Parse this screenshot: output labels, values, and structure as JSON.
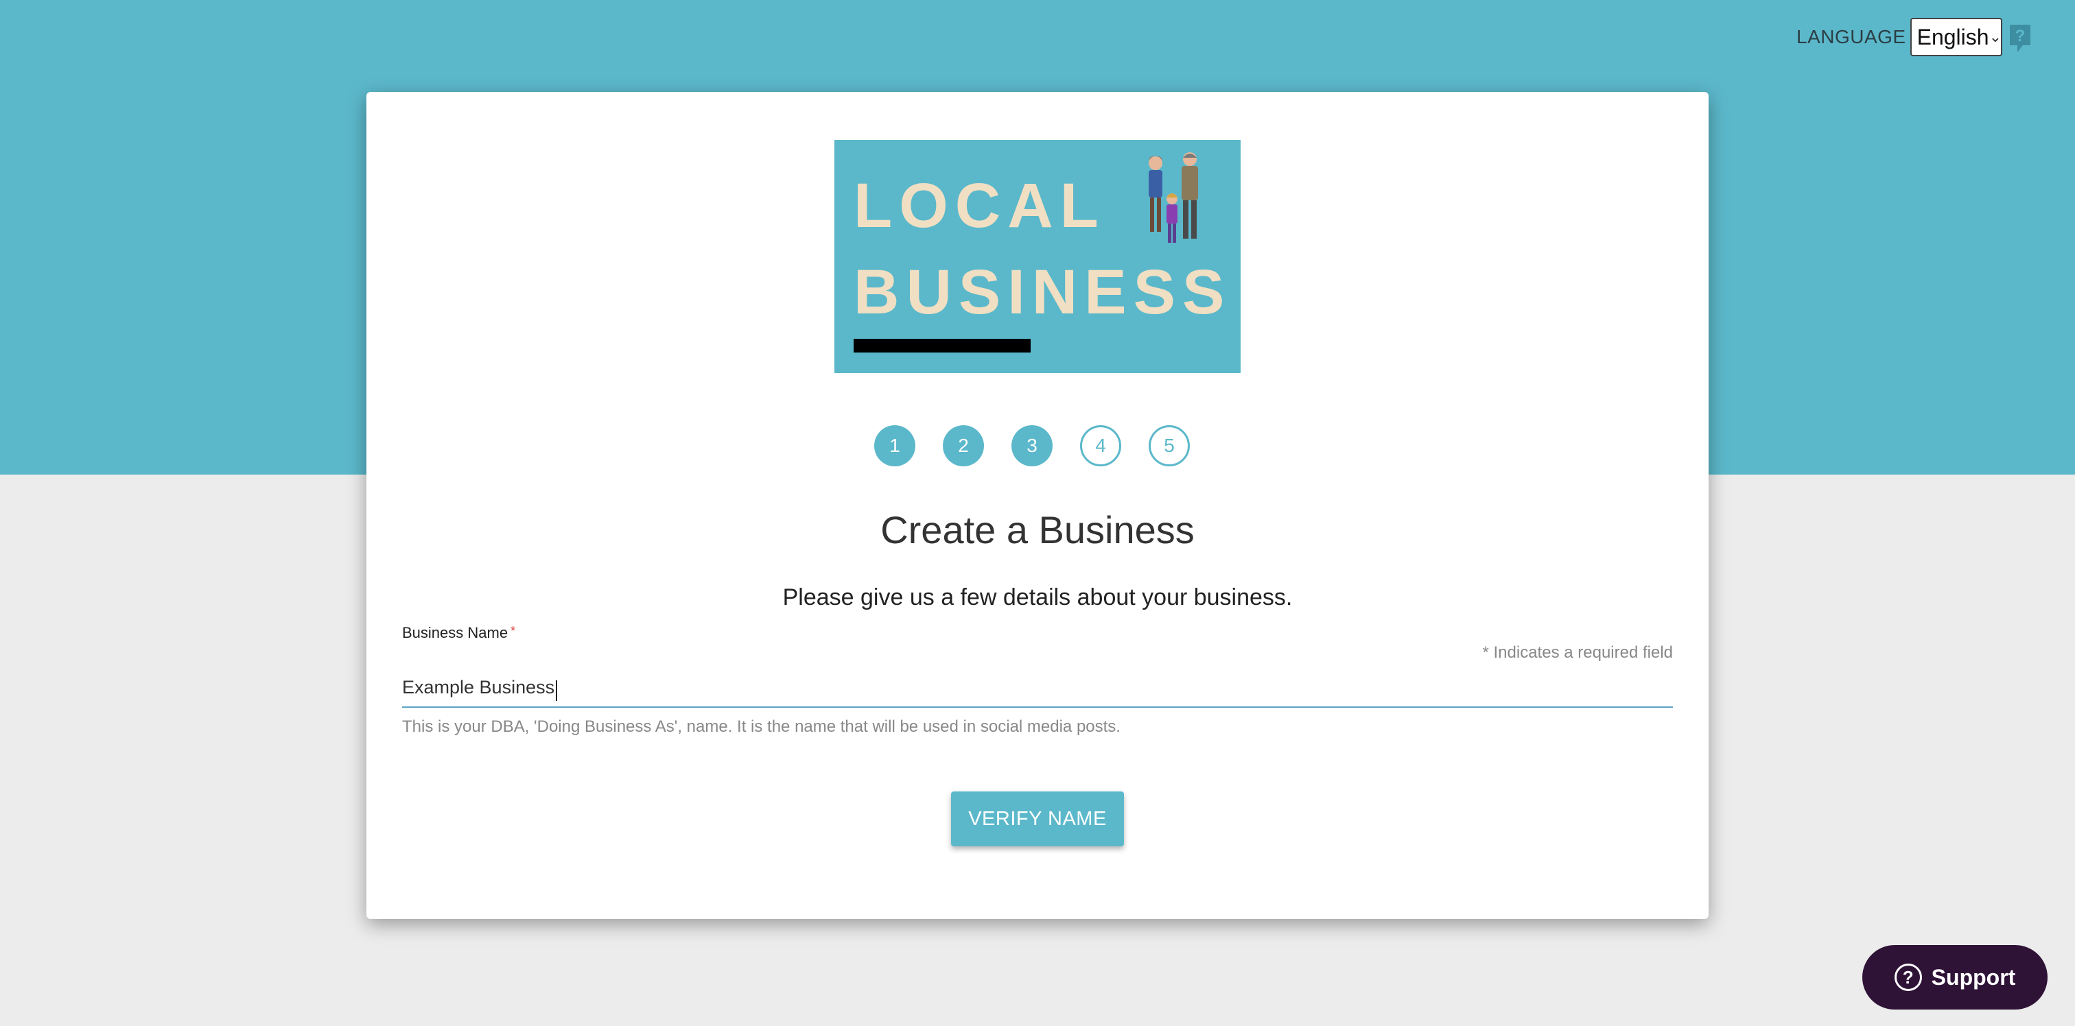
{
  "header": {
    "language_label": "LANGUAGE",
    "language_selected": "English",
    "help_icon": "question-bubble-icon",
    "accent_color": "#5bb8ca"
  },
  "logo": {
    "line1": "LOCAL",
    "line2": "BUSINESS",
    "image": "family-illustration"
  },
  "steps": [
    {
      "label": "1",
      "state": "done"
    },
    {
      "label": "2",
      "state": "done"
    },
    {
      "label": "3",
      "state": "done"
    },
    {
      "label": "4",
      "state": "todo"
    },
    {
      "label": "5",
      "state": "todo"
    }
  ],
  "form": {
    "title": "Create a Business",
    "subtitle": "Please give us a few details about your business.",
    "field_label": "Business Name",
    "required_mark": "*",
    "required_note": "* Indicates a required field",
    "field_value": "Example Business",
    "hint": "This is your DBA, 'Doing Business As', name. It is the name that will be used in social media posts.",
    "verify_button": "VERIFY NAME"
  },
  "support": {
    "label": "Support",
    "icon": "question-circle-icon",
    "color": "#2f1337"
  }
}
